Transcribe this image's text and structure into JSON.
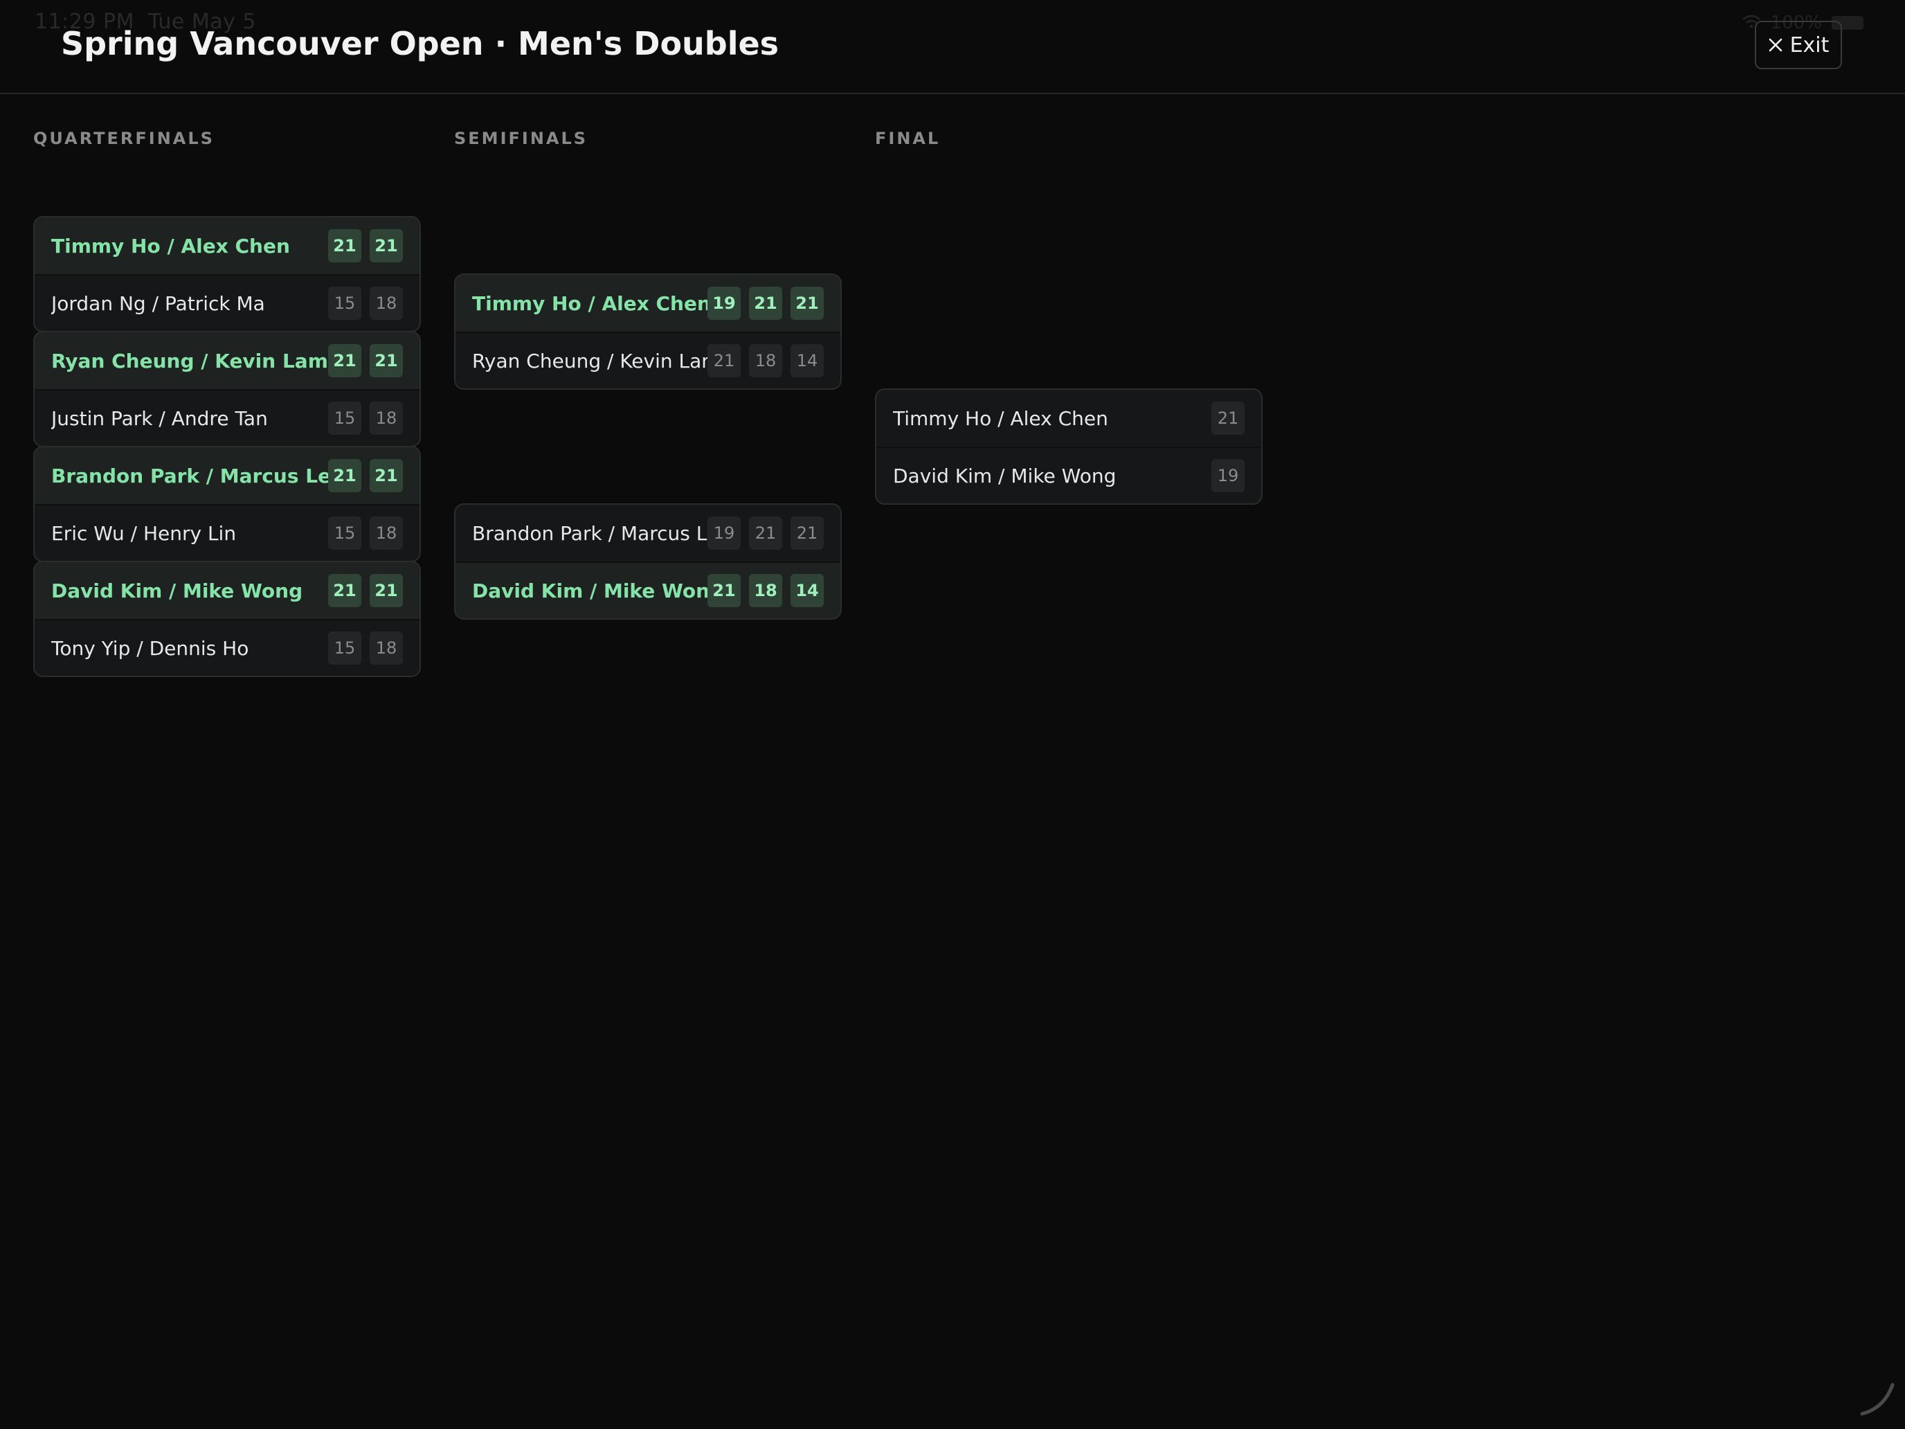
{
  "status_bar": {
    "time": "11:29 PM",
    "date": "Tue May 5",
    "battery": "100%"
  },
  "header": {
    "title": "Spring Vancouver Open · Men's Doubles",
    "exit_label": "Exit"
  },
  "rounds": [
    {
      "label": "QUARTERFINALS",
      "matches": [
        {
          "teams": [
            {
              "name": "Timmy Ho / Alex Chen",
              "winner": true,
              "scores": [
                "21",
                "21"
              ]
            },
            {
              "name": "Jordan Ng / Patrick Ma",
              "winner": false,
              "scores": [
                "15",
                "18"
              ]
            }
          ]
        },
        {
          "teams": [
            {
              "name": "Ryan Cheung / Kevin Lam",
              "winner": true,
              "scores": [
                "21",
                "21"
              ]
            },
            {
              "name": "Justin Park / Andre Tan",
              "winner": false,
              "scores": [
                "15",
                "18"
              ]
            }
          ]
        },
        {
          "teams": [
            {
              "name": "Brandon Park / Marcus Lee",
              "winner": true,
              "scores": [
                "21",
                "21"
              ]
            },
            {
              "name": "Eric Wu / Henry Lin",
              "winner": false,
              "scores": [
                "15",
                "18"
              ]
            }
          ]
        },
        {
          "teams": [
            {
              "name": "David Kim / Mike Wong",
              "winner": true,
              "scores": [
                "21",
                "21"
              ]
            },
            {
              "name": "Tony Yip / Dennis Ho",
              "winner": false,
              "scores": [
                "15",
                "18"
              ]
            }
          ]
        }
      ]
    },
    {
      "label": "SEMIFINALS",
      "matches": [
        {
          "teams": [
            {
              "name": "Timmy Ho / Alex Chen",
              "winner": true,
              "scores": [
                "19",
                "21",
                "21"
              ]
            },
            {
              "name": "Ryan Cheung / Kevin Lam",
              "winner": false,
              "scores": [
                "21",
                "18",
                "14"
              ]
            }
          ]
        },
        {
          "teams": [
            {
              "name": "Brandon Park / Marcus Lee",
              "winner": false,
              "scores": [
                "19",
                "21",
                "21"
              ]
            },
            {
              "name": "David Kim / Mike Wong",
              "winner": true,
              "scores": [
                "21",
                "18",
                "14"
              ]
            }
          ]
        }
      ]
    },
    {
      "label": "FINAL",
      "matches": [
        {
          "teams": [
            {
              "name": "Timmy Ho / Alex Chen",
              "winner": false,
              "scores": [
                "21"
              ]
            },
            {
              "name": "David Kim / Mike Wong",
              "winner": false,
              "scores": [
                "19"
              ]
            }
          ]
        }
      ]
    }
  ],
  "colors": {
    "background": "#0b0b0b",
    "winner_text": "#86e3a8",
    "winner_score_bg": "#2f4436",
    "card_bg": "#161718"
  },
  "icons": {
    "exit": "close-icon"
  }
}
